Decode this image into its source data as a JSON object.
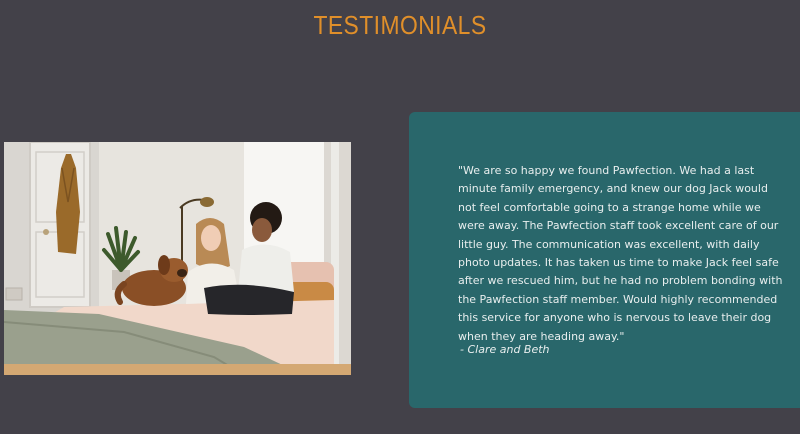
{
  "section": {
    "title": "TESTIMONIALS"
  },
  "testimonial": {
    "quote": "\"We are so happy we found Pawfection. We had a last minute family emergency, and knew our dog Jack would not feel comfortable going to a strange home while we were away. The Pawfection staff took excellent care of our little guy. The communication was excellent, with daily photo updates. It has taken us time to make Jack feel safe after we rescued him, but he had no problem bonding with the Pawfection staff member. Would highly recommended this service for anyone who is nervous to leave their dog when they are heading away.\"",
    "author": "- Clare and Beth"
  },
  "colors": {
    "background": "#434149",
    "accent": "#e08f2a",
    "card": "#29676b",
    "card_text": "#e8eeee"
  }
}
